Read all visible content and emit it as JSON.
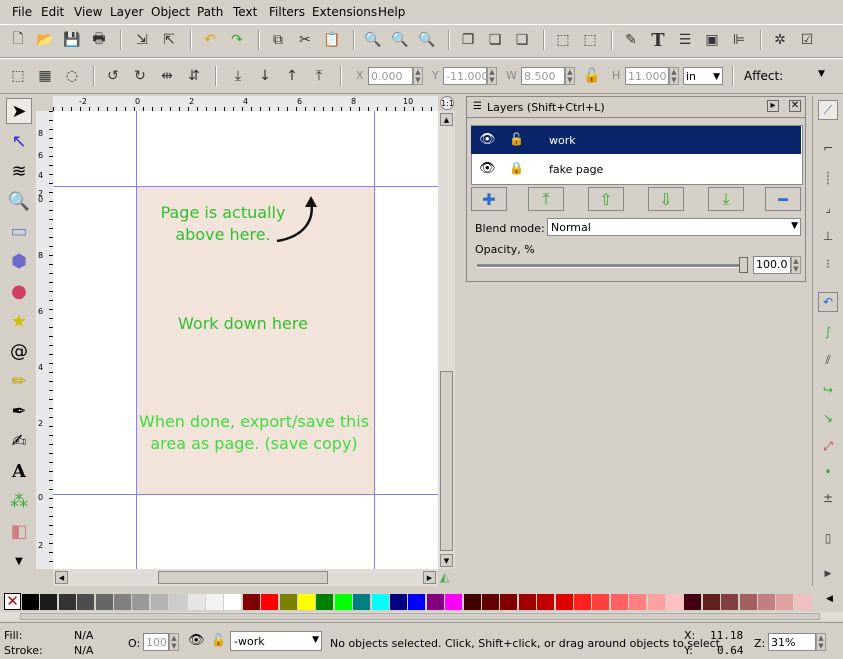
{
  "menu": [
    "File",
    "Edit",
    "View",
    "Layer",
    "Object",
    "Path",
    "Text",
    "Filters",
    "Extensions",
    "Help"
  ],
  "toolbar2": {
    "x_label": "X",
    "x_value": "0.000",
    "y_label": "Y",
    "y_value": "-11.000",
    "w_label": "W",
    "w_value": "8.500",
    "h_label": "H",
    "h_value": "11.000",
    "unit": "in",
    "affect_label": "Affect:"
  },
  "ruler": {
    "top": [
      "-2",
      "0",
      "2",
      "4",
      "6",
      "8",
      "10"
    ],
    "left": [
      "8",
      "6",
      "4",
      "2",
      "0",
      "8",
      "6",
      "4",
      "2",
      "0",
      "2"
    ],
    "corner": "1:1"
  },
  "canvas": {
    "note1": "Page is actually\nabove here.",
    "note2": "Work down here",
    "note3": "When done, export/save this\narea as page. (save copy)"
  },
  "layers": {
    "title": "Layers (Shift+Ctrl+L)",
    "rows": [
      {
        "name": "work",
        "selected": true
      },
      {
        "name": "fake page",
        "selected": false
      }
    ],
    "blend_label": "Blend mode:",
    "blend_value": "Normal",
    "opacity_label": "Opacity, %",
    "opacity_value": "100.0",
    "opacity_level": 1.0
  },
  "palette": [
    "#000000",
    "#1a1a1a",
    "#333333",
    "#4d4d4d",
    "#666666",
    "#808080",
    "#999999",
    "#b3b3b3",
    "#cccccc",
    "#e6e6e6",
    "#f2f2f2",
    "#ffffff",
    "#800000",
    "#ff0000",
    "#808000",
    "#ffff00",
    "#008000",
    "#00ff00",
    "#008080",
    "#00ffff",
    "#000080",
    "#0000ff",
    "#800080",
    "#ff00ff",
    "#400000",
    "#600000",
    "#800000",
    "#a00000",
    "#c00000",
    "#e00000",
    "#ff2020",
    "#ff4040",
    "#ff6060",
    "#ff8080",
    "#ffa0a0",
    "#ffc0c0",
    "#400010",
    "#602020",
    "#804040",
    "#a06060",
    "#c08080",
    "#e0a0a0",
    "#f0c0c0"
  ],
  "status": {
    "fill_label": "Fill:",
    "fill_value": "N/A",
    "stroke_label": "Stroke:",
    "stroke_value": "N/A",
    "o_label": "O:",
    "o_value": "100",
    "layer_value": "-work",
    "message": "No objects selected. Click, Shift+click, or drag around objects to select.",
    "x_label": "X:",
    "x_value": "11.18",
    "y_label": "Y:",
    "y_value": "0.64",
    "z_label": "Z:",
    "zoom": "31%"
  }
}
